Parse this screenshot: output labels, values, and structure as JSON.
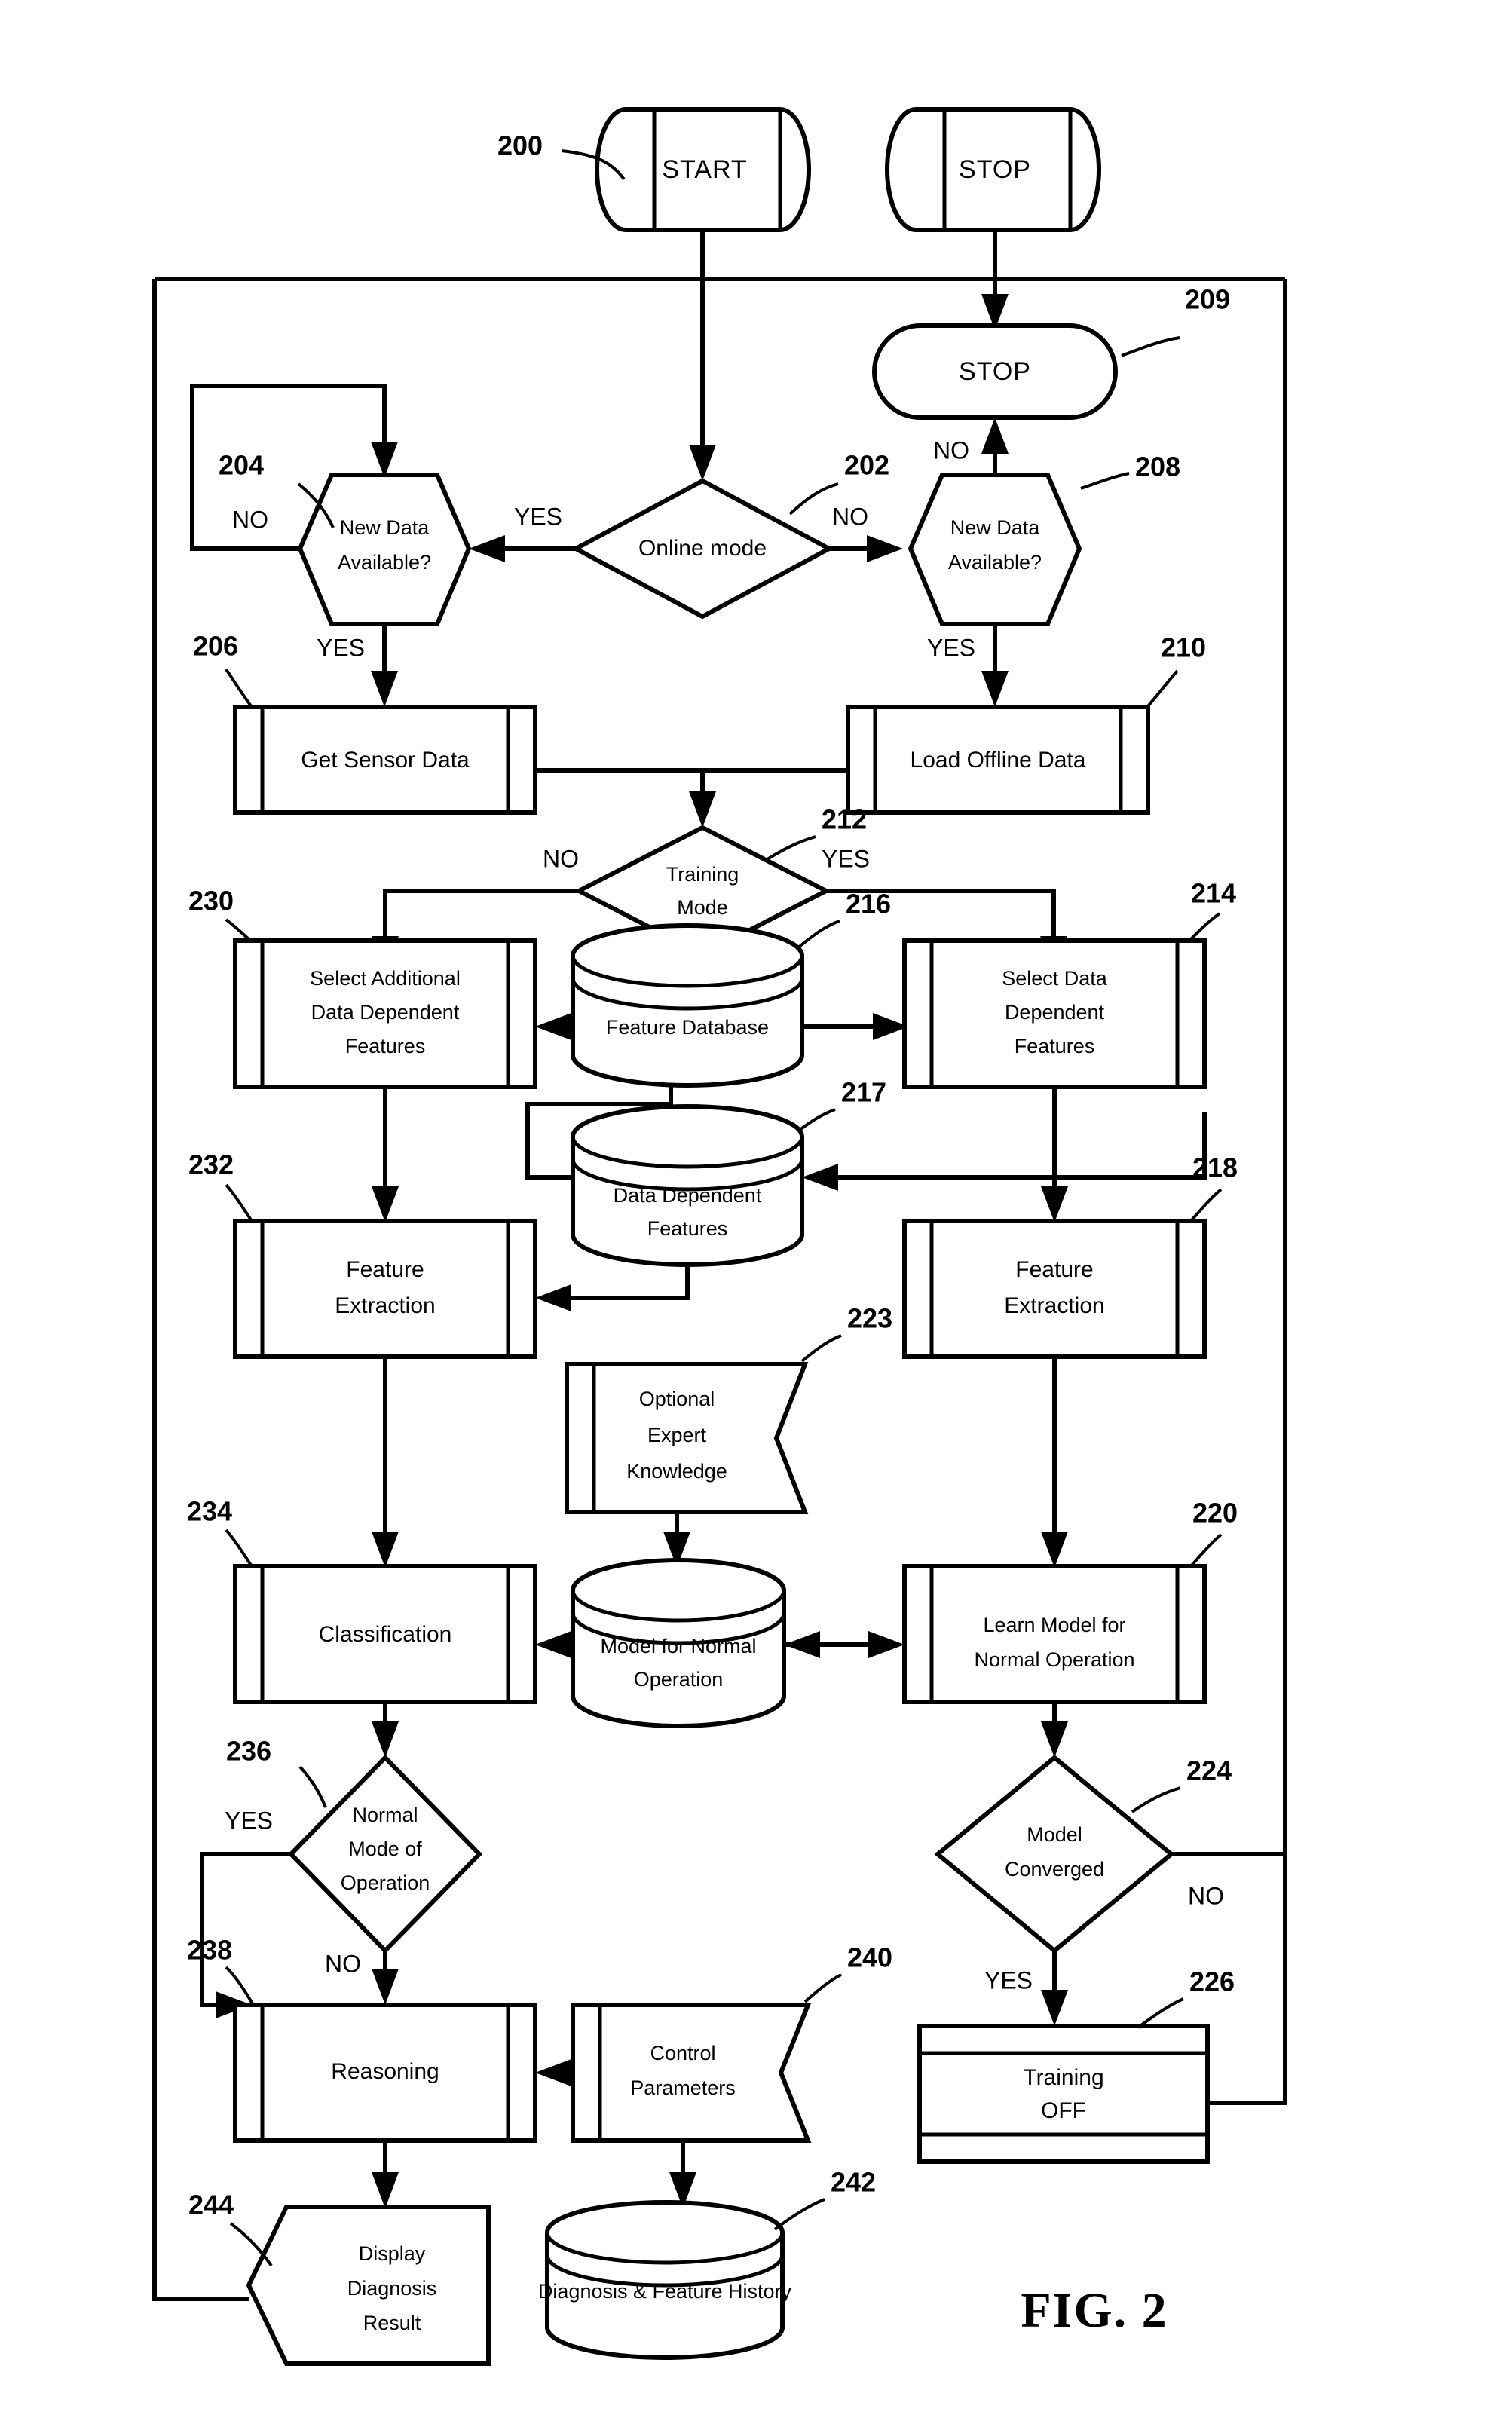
{
  "figure": {
    "label": "FIG. 2"
  },
  "nodes": {
    "n200": {
      "ref": "200",
      "label": "START",
      "shape": "terminator-cylinder"
    },
    "n201": {
      "label": "STOP",
      "shape": "terminator-cylinder"
    },
    "n209": {
      "ref": "209",
      "label": "STOP",
      "shape": "stadium"
    },
    "n202": {
      "ref": "202",
      "label": "Online mode",
      "shape": "diamond"
    },
    "n204": {
      "ref": "204",
      "label_line1": "New Data",
      "label_line2": "Available?",
      "shape": "hexagon"
    },
    "n208": {
      "ref": "208",
      "label_line1": "New Data",
      "label_line2": "Available?",
      "shape": "hexagon"
    },
    "n206": {
      "ref": "206",
      "label": "Get Sensor Data",
      "shape": "predefined-process"
    },
    "n210": {
      "ref": "210",
      "label": "Load Offline Data",
      "shape": "predefined-process"
    },
    "n212": {
      "ref": "212",
      "label_line1": "Training",
      "label_line2": "Mode",
      "shape": "diamond"
    },
    "n230": {
      "ref": "230",
      "label_line1": "Select Additional",
      "label_line2": "Data Dependent",
      "label_line3": "Features",
      "shape": "predefined-process"
    },
    "n216": {
      "ref": "216",
      "label": "Feature Database",
      "shape": "database"
    },
    "n214": {
      "ref": "214",
      "label_line1": "Select Data",
      "label_line2": "Dependent",
      "label_line3": "Features",
      "shape": "predefined-process"
    },
    "n217": {
      "ref": "217",
      "label_line1": "Data Dependent",
      "label_line2": "Features",
      "shape": "database"
    },
    "n232": {
      "ref": "232",
      "label_line1": "Feature",
      "label_line2": "Extraction",
      "shape": "predefined-process"
    },
    "n218": {
      "ref": "218",
      "label_line1": "Feature",
      "label_line2": "Extraction",
      "shape": "predefined-process"
    },
    "n223": {
      "ref": "223",
      "label_line1": "Optional",
      "label_line2": "Expert",
      "label_line3": "Knowledge",
      "shape": "right-notched-card"
    },
    "n234": {
      "ref": "234",
      "label": "Classification",
      "shape": "predefined-process"
    },
    "n222": {
      "label_line1": "Model for Normal",
      "label_line2": "Operation",
      "shape": "database"
    },
    "n220": {
      "ref": "220",
      "label_line1": "Learn Model for",
      "label_line2": "Normal Operation",
      "shape": "predefined-process"
    },
    "n236": {
      "ref": "236",
      "label_line1": "Normal",
      "label_line2": "Mode of",
      "label_line3": "Operation",
      "shape": "diamond"
    },
    "n224": {
      "ref": "224",
      "label_line1": "Model",
      "label_line2": "Converged",
      "shape": "diamond"
    },
    "n238": {
      "ref": "238",
      "label": "Reasoning",
      "shape": "predefined-process"
    },
    "n240": {
      "ref": "240",
      "label_line1": "Control",
      "label_line2": "Parameters",
      "shape": "right-notched-card"
    },
    "n226": {
      "ref": "226",
      "label_line1": "Training",
      "label_line2": "OFF",
      "shape": "horizontal-banded-box"
    },
    "n244": {
      "ref": "244",
      "label_line1": "Display",
      "label_line2": "Diagnosis",
      "label_line3": "Result",
      "shape": "left-notched-card"
    },
    "n242": {
      "ref": "242",
      "label": "Diagnosis & Feature History",
      "shape": "database"
    }
  },
  "edge_labels": {
    "e202_yes": "YES",
    "e202_no": "NO",
    "e204_no": "NO",
    "e204_yes": "YES",
    "e208_no": "NO",
    "e208_yes": "YES",
    "e212_no": "NO",
    "e212_yes": "YES",
    "e236_yes": "YES",
    "e236_no": "NO",
    "e224_no": "NO",
    "e224_yes": "YES"
  },
  "colors": {
    "stroke": "#000000",
    "fill": "#ffffff",
    "background": "#ffffff"
  }
}
